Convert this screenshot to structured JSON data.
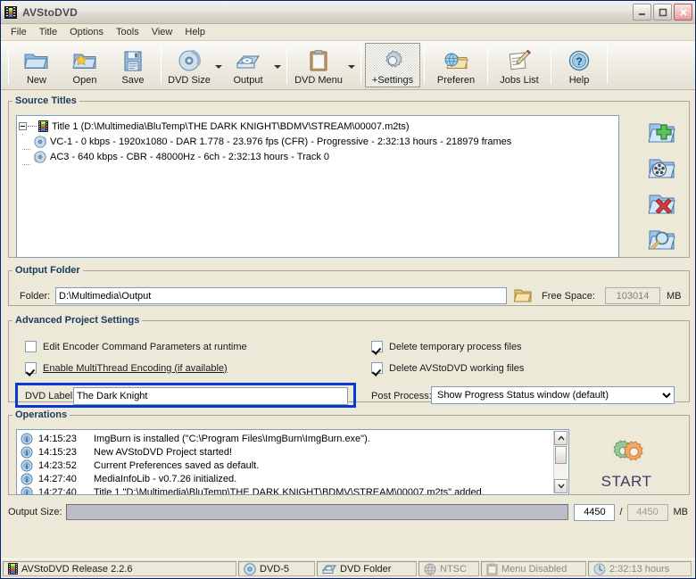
{
  "window": {
    "title": "AVStoDVD",
    "app_icon": "film-strip-icon",
    "controls": {
      "minimize": "minimize-icon",
      "maximize": "maximize-icon",
      "close": "close-icon"
    }
  },
  "menubar": {
    "items": [
      {
        "label": "File"
      },
      {
        "label": "Title"
      },
      {
        "label": "Options"
      },
      {
        "label": "Tools"
      },
      {
        "label": "View"
      },
      {
        "label": "Help"
      }
    ]
  },
  "toolbar": {
    "buttons": [
      {
        "label": "New",
        "icon": "new-folder-icon"
      },
      {
        "label": "Open",
        "icon": "open-folder-star-icon"
      },
      {
        "label": "Save",
        "icon": "floppy-disk-icon"
      },
      {
        "label": "DVD Size",
        "icon": "dvd-disc-icon",
        "dropdown": true
      },
      {
        "label": "Output",
        "icon": "dvd-drive-icon",
        "dropdown": true
      },
      {
        "label": "DVD Menu",
        "icon": "clipboard-icon",
        "dropdown": true
      },
      {
        "label": "+Settings",
        "icon": "gear-icon",
        "checked": true
      },
      {
        "label": "Preferen",
        "icon": "globe-folder-icon"
      },
      {
        "label": "Jobs List",
        "icon": "notepad-pencil-icon"
      },
      {
        "label": "Help",
        "icon": "question-help-icon"
      }
    ]
  },
  "source_titles": {
    "legend": "Source Titles",
    "tree": [
      {
        "icon": "film-strip-icon",
        "text": "Title 1 (D:\\Multimedia\\BluTemp\\THE DARK KNIGHT\\BDMV\\STREAM\\00007.m2ts)",
        "children": [
          {
            "icon": "video-disc-icon",
            "text": "VC-1 - 0 kbps - 1920x1080 - DAR 1.778 - 23.976 fps (CFR) - Progressive - 2:32:13 hours - 218979 frames"
          },
          {
            "icon": "audio-disc-icon",
            "text": "AC3 - 640 kbps - CBR - 48000Hz - 6ch - 2:32:13 hours - Track 0"
          }
        ]
      }
    ],
    "side_buttons": [
      {
        "name": "add-title-button",
        "icon": "folder-add-icon"
      },
      {
        "name": "edit-title-button",
        "icon": "folder-film-icon"
      },
      {
        "name": "remove-title-button",
        "icon": "folder-delete-icon"
      },
      {
        "name": "preview-title-button",
        "icon": "folder-search-icon"
      }
    ]
  },
  "output_folder": {
    "legend": "Output Folder",
    "folder_label": "Folder:",
    "folder_value": "D:\\Multimedia\\Output",
    "browse_icon": "open-folder-icon",
    "free_space_label": "Free Space:",
    "free_space_value": "103014",
    "free_space_unit": "MB"
  },
  "advanced_settings": {
    "legend": "Advanced Project Settings",
    "checkboxes": [
      {
        "label": "Edit Encoder Command Parameters at runtime",
        "checked": false,
        "link": false
      },
      {
        "label": "Enable MultiThread Encoding (if available)",
        "checked": true,
        "link": true
      },
      {
        "label": "Delete temporary process files",
        "checked": true,
        "link": false
      },
      {
        "label": "Delete AVStoDVD working files",
        "checked": true,
        "link": false
      }
    ],
    "dvd_label_label": "DVD Label:",
    "dvd_label_value": "The Dark Knight",
    "post_process_label": "Post Process:",
    "post_process_value": "Show Progress Status window (default)",
    "post_process_options": [
      "Show Progress Status window (default)"
    ],
    "highlight_color": "#0a37d4"
  },
  "operations": {
    "legend": "Operations",
    "rows": [
      {
        "icon": "info-icon",
        "time": "14:15:23",
        "message": "ImgBurn is installed (\"C:\\Program Files\\ImgBurn\\ImgBurn.exe\")."
      },
      {
        "icon": "info-icon",
        "time": "14:15:23",
        "message": "New AVStoDVD Project started!"
      },
      {
        "icon": "info-icon",
        "time": "14:23:52",
        "message": "Current Preferences saved as default."
      },
      {
        "icon": "info-icon",
        "time": "14:27:40",
        "message": "MediaInfoLib - v0.7.26 initialized."
      },
      {
        "icon": "info-icon",
        "time": "14:27:40",
        "message": "Title 1 \"D:\\Multimedia\\BluTemp\\THE DARK KNIGHT\\BDMV\\STREAM\\00007.m2ts\" added."
      }
    ],
    "start_label": "START",
    "start_icon": "gears-icon"
  },
  "output_size": {
    "label": "Output Size:",
    "current": "4450",
    "separator": "/",
    "total": "4450",
    "unit": "MB",
    "progress_percent": 0
  },
  "statusbar": {
    "cells": [
      {
        "icon": "film-strip-icon",
        "text": "AVStoDVD Release 2.2.6",
        "dim": false
      },
      {
        "icon": "dvd-disc-icon",
        "text": "DVD-5",
        "dim": false
      },
      {
        "icon": "dvd-drive-icon",
        "text": "DVD Folder",
        "dim": false
      },
      {
        "icon": "globe-icon",
        "text": "NTSC",
        "dim": true
      },
      {
        "icon": "clipboard-icon",
        "text": "Menu Disabled",
        "dim": true
      },
      {
        "icon": "clock-icon",
        "text": "2:32:13 hours",
        "dim": true
      }
    ]
  }
}
